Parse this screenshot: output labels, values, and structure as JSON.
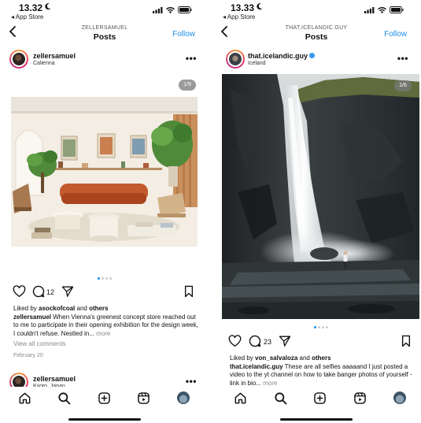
{
  "left": {
    "status": {
      "time": "13.32",
      "back_app": "◂ App Store"
    },
    "nav": {
      "username": "ZELLERSAMUEL",
      "title": "Posts",
      "follow": "Follow"
    },
    "post": {
      "username": "zellersamuel",
      "location": "Calienna",
      "counter": "1/9",
      "comments_count": "12",
      "liked_by_prefix": "Liked by ",
      "liked_by_user": "asockofcoal",
      "liked_by_and": " and ",
      "liked_by_others": "others",
      "caption_user": "zellersamuel",
      "caption_text": " When Vienna's greenest concept store reached out to me to participate in their opening exhibition for the design week, I couldn't refuse. Nestled in...",
      "caption_more": " more",
      "view_comments": "View all comments",
      "date": "February 20"
    },
    "next_post": {
      "username": "zellersamuel",
      "location": "Kyoto, Japan"
    }
  },
  "right": {
    "status": {
      "time": "13.33",
      "back_app": "◂ App Store"
    },
    "nav": {
      "username": "THAT.ICELANDIC.GUY",
      "title": "Posts",
      "follow": "Follow"
    },
    "post": {
      "username": "that.icelandic.guy",
      "location": "Iceland",
      "counter": "1/6",
      "comments_count": "23",
      "liked_by_prefix": "Liked by ",
      "liked_by_user": "von_salvaloza",
      "liked_by_and": " and ",
      "liked_by_others": "others",
      "caption_user": "that.icelandic.guy",
      "caption_text": " These are all selfies aaaaand I just posted a video to the yt channel on how to take banger photos of yourself - link in bio...",
      "caption_more": " more"
    }
  },
  "colors": {
    "accent_blue": "#1e8ee6",
    "muted_text": "#8a8a8a",
    "verified_blue": "#3897f0"
  },
  "icons": [
    "chevron-left-icon",
    "signal-icon",
    "wifi-icon",
    "battery-icon",
    "more-icon",
    "heart-icon",
    "comment-icon",
    "share-icon",
    "bookmark-icon",
    "home-icon",
    "search-icon",
    "add-post-icon",
    "reels-icon",
    "profile-icon",
    "moon-icon"
  ]
}
